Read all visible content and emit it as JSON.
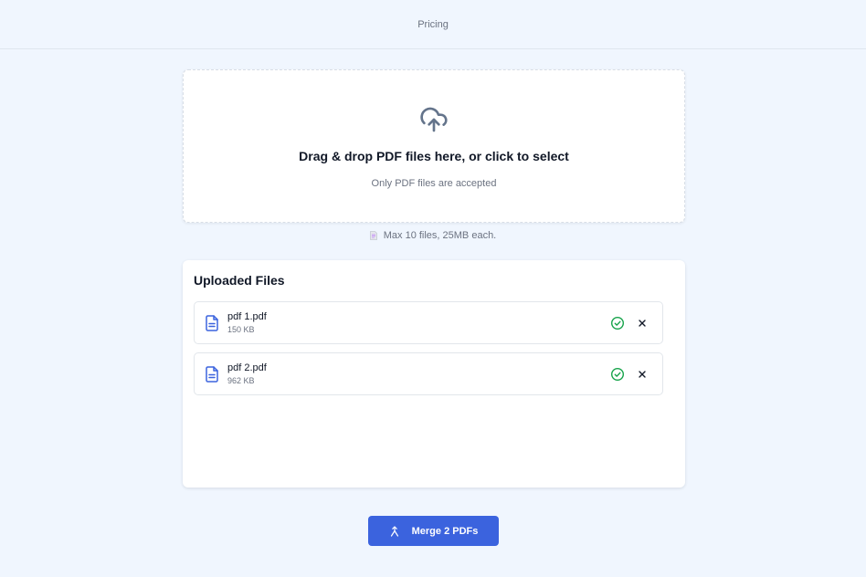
{
  "header": {
    "nav_link": "Pricing"
  },
  "dropzone": {
    "icon": "cloud-upload-icon",
    "title": "Drag & drop PDF files here, or click to select",
    "subtitle": "Only PDF files are accepted"
  },
  "limits": {
    "icon": "document-icon",
    "text": "Max 10 files, 25MB each."
  },
  "uploaded": {
    "title": "Uploaded Files",
    "files": [
      {
        "name": "pdf 1.pdf",
        "size": "150 KB",
        "status": "uploaded"
      },
      {
        "name": "pdf 2.pdf",
        "size": "962 KB",
        "status": "uploaded"
      }
    ]
  },
  "merge_button": {
    "label": "Merge 2 PDFs",
    "icon": "merge-icon"
  },
  "colors": {
    "background": "#f0f6fe",
    "accent": "#3b63de",
    "success": "#16a34a",
    "file_icon": "#3b63de"
  }
}
